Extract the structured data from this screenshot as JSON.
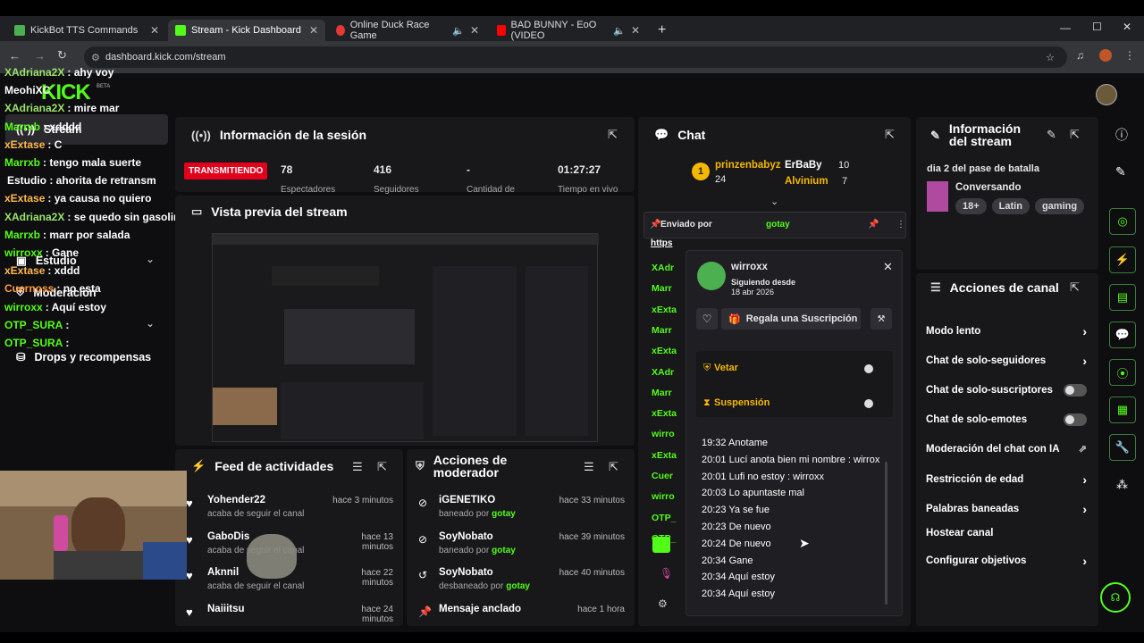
{
  "tabs": [
    {
      "label": "KickBot TTS Commands",
      "color": "#4caf50"
    },
    {
      "label": "Stream - Kick Dashboard",
      "color": "#53fc18"
    },
    {
      "label": "Online Duck Race Game",
      "color": "#e53935"
    },
    {
      "label": "BAD BUNNY - EoO (VIDEO",
      "color": "#ff0000"
    }
  ],
  "url": "dashboard.kick.com/stream",
  "logo": "KICK",
  "logo_badge": "BETA",
  "nav": [
    "Stream",
    "Estudio",
    "Moderación",
    "Drops y recompensas"
  ],
  "overlay_chat": [
    {
      "user": "XAdriana2X",
      "text": ": ahy voy",
      "color": "#9be36b"
    },
    {
      "user": "MeohiXC",
      "text": "",
      "color": "#ffffff"
    },
    {
      "user": "XAdriana2X",
      "text": ": mire mar",
      "color": "#9be36b"
    },
    {
      "user": "Marrxb",
      "text": ": xdddd",
      "color": "#53fc18"
    },
    {
      "user": "xExtase",
      "text": ": C",
      "color": "#ffb84d"
    },
    {
      "user": "Marrxb",
      "text": ": tengo mala suerte",
      "color": "#53fc18"
    },
    {
      "user": "",
      "text": "Estudio : ahorita de retransm",
      "color": "#ffffff"
    },
    {
      "user": "xExtase",
      "text": ": ya causa no quiero",
      "color": "#ffb84d"
    },
    {
      "user": "XAdriana2X",
      "text": ": se quedo sin gasolina",
      "color": "#9be36b"
    },
    {
      "user": "Marrxb",
      "text": ": marr por salada",
      "color": "#53fc18"
    },
    {
      "user": "wirroxx",
      "text": ": Gane",
      "color": "#53fc18"
    },
    {
      "user": "xExtase",
      "text": ": xddd",
      "color": "#ffb84d"
    },
    {
      "user": "Cuernoss",
      "text": ": no esta",
      "color": "#ff9a3c"
    },
    {
      "user": "wirroxx",
      "text": ": Aquí estoy",
      "color": "#53fc18"
    },
    {
      "user": "OTP_SURA",
      "text": ":",
      "color": "#53fc18"
    },
    {
      "user": "OTP_SURA",
      "text": ":",
      "color": "#53fc18"
    }
  ],
  "session": {
    "title": "Información de la sesión",
    "live": "TRANSMITIENDO",
    "stats": [
      {
        "value": "78",
        "label": "Espectadores"
      },
      {
        "value": "416",
        "label": "Seguidores"
      },
      {
        "value": "-",
        "label": "Cantidad de"
      },
      {
        "value": "01:27:27",
        "label": "Tiempo en vivo"
      }
    ]
  },
  "preview": {
    "title": "Vista previa del stream"
  },
  "feed": {
    "title": "Feed de actividades",
    "items": [
      {
        "user": "Yohender22",
        "action": "acaba de seguir el canal",
        "time": "hace 3 minutos"
      },
      {
        "user": "GaboDis",
        "action": "acaba de seguir el canal",
        "time": "hace 13 minutos"
      },
      {
        "user": "Aknnil",
        "action": "acaba de seguir el canal",
        "time": "hace 22 minutos"
      },
      {
        "user": "Naiiitsu",
        "action": "",
        "time": "hace 24 minutos"
      }
    ]
  },
  "modactions": {
    "title": "Acciones de moderador",
    "items": [
      {
        "user": "iGENETIKO",
        "action": "baneado por",
        "by": "gotay",
        "time": "hace 33 minutos"
      },
      {
        "user": "SoyNobato",
        "action": "baneado por",
        "by": "gotay",
        "time": "hace 39 minutos"
      },
      {
        "user": "SoyNobato",
        "action": "desbaneado por",
        "by": "gotay",
        "time": "hace 40 minutos"
      },
      {
        "user": "Mensaje anclado",
        "action": "",
        "by": "",
        "time": "hace 1 hora"
      }
    ]
  },
  "chat": {
    "title": "Chat",
    "top1": {
      "user": "prinzenbabyz",
      "count": "24"
    },
    "top2": {
      "user": "ErBaBy",
      "count": "10"
    },
    "top3": {
      "user": "Alvinium",
      "count": "7"
    },
    "pinned_label": "Enviado por",
    "pinned_by": "gotay",
    "pinned_link": "https",
    "names": [
      "XAdr",
      "Marr",
      "xExta",
      "Marr",
      "xExta",
      "XAdr",
      "Marr",
      "xExta",
      "wirro",
      "xExta",
      "Cuer",
      "wirro",
      "OTP_",
      "OTP_"
    ]
  },
  "user_card": {
    "name": "wirroxx",
    "since_label": "Siguiendo desde",
    "since_date": "18 abr 2026",
    "gift": "Regala una Suscripción",
    "ban": "Vetar",
    "timeout": "Suspensión",
    "messages": [
      "19:32 Anotame",
      "20:01 Lucí anota bien mi nombre : wirrox",
      "20:01 Lufi no estoy : wirroxx",
      "20:03 Lo apuntaste mal",
      "20:23 Ya se fue",
      "20:23 De nuevo",
      "20:24 De nuevo",
      "20:34 Gane",
      "20:34 Aquí estoy",
      "20:34 Aquí estoy"
    ]
  },
  "stream_info": {
    "title": "Información del stream",
    "stream_title": "dia 2 del pase de batalla",
    "category": "Conversando",
    "tags": [
      "18+",
      "Latin",
      "gaming"
    ]
  },
  "channel_actions": {
    "title": "Acciones de canal",
    "items": [
      {
        "label": "Modo lento",
        "control": "arrow"
      },
      {
        "label": "Chat de solo-seguidores",
        "control": "arrow"
      },
      {
        "label": "Chat de solo-suscriptores",
        "control": "toggle"
      },
      {
        "label": "Chat de solo-emotes",
        "control": "toggle"
      },
      {
        "label": "Moderación del chat con IA",
        "control": "external"
      },
      {
        "label": "Restricción de edad",
        "control": "arrow"
      },
      {
        "label": "Palabras baneadas",
        "control": "arrow"
      },
      {
        "label": "Hostear canal",
        "control": "none"
      },
      {
        "label": "Configurar objetivos",
        "control": "arrow"
      }
    ]
  }
}
